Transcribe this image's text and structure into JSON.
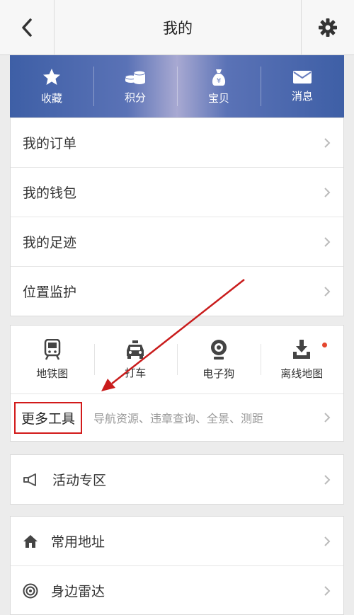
{
  "header": {
    "title": "我的",
    "back_icon": "chevron-left-icon",
    "settings_icon": "gear-icon"
  },
  "quick_bar": [
    {
      "label": "收藏",
      "icon": "star-icon"
    },
    {
      "label": "积分",
      "icon": "coins-icon"
    },
    {
      "label": "宝贝",
      "icon": "money-bag-icon"
    },
    {
      "label": "消息",
      "icon": "envelope-icon"
    }
  ],
  "account_menu": [
    "我的订单",
    "我的钱包",
    "我的足迹",
    "位置监护"
  ],
  "tools": [
    {
      "label": "地铁图",
      "icon": "subway-icon"
    },
    {
      "label": "打车",
      "icon": "taxi-icon"
    },
    {
      "label": "电子狗",
      "icon": "camera-icon"
    },
    {
      "label": "离线地图",
      "icon": "download-icon",
      "badge": true
    }
  ],
  "more_tools": {
    "label": "更多工具",
    "description": "导航资源、违章查询、全景、测距"
  },
  "activity": {
    "label": "活动专区",
    "icon": "megaphone-icon"
  },
  "places": [
    {
      "label": "常用地址",
      "icon": "home-icon"
    },
    {
      "label": "身边雷达",
      "icon": "radar-icon"
    }
  ],
  "colors": {
    "hero_blue": "#3e5fa6",
    "annotation_red": "#d21a1a",
    "badge_red": "#e4462e"
  }
}
